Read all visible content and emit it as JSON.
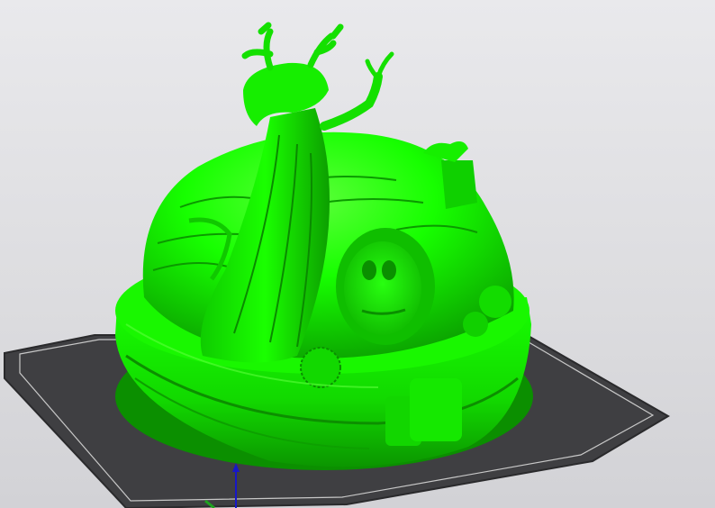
{
  "viewport": {
    "background_colors": [
      "#e9e9ec",
      "#d2d2d6"
    ]
  },
  "print_bed": {
    "plate_color": "#3f3f42",
    "plate_edge_color": "#2a2a2c",
    "boundary_line_color": "#c8c8c8"
  },
  "model": {
    "description_icon": "fantasy-tree-house-model",
    "color": "#17ff00",
    "shadow_color": "#0a9e00",
    "dark_color": "#0c7d00",
    "highlight_color": "#7dff5e"
  },
  "axes": {
    "z_axis_color": "#1717c8",
    "x_axis_color": "#1fa31f"
  }
}
